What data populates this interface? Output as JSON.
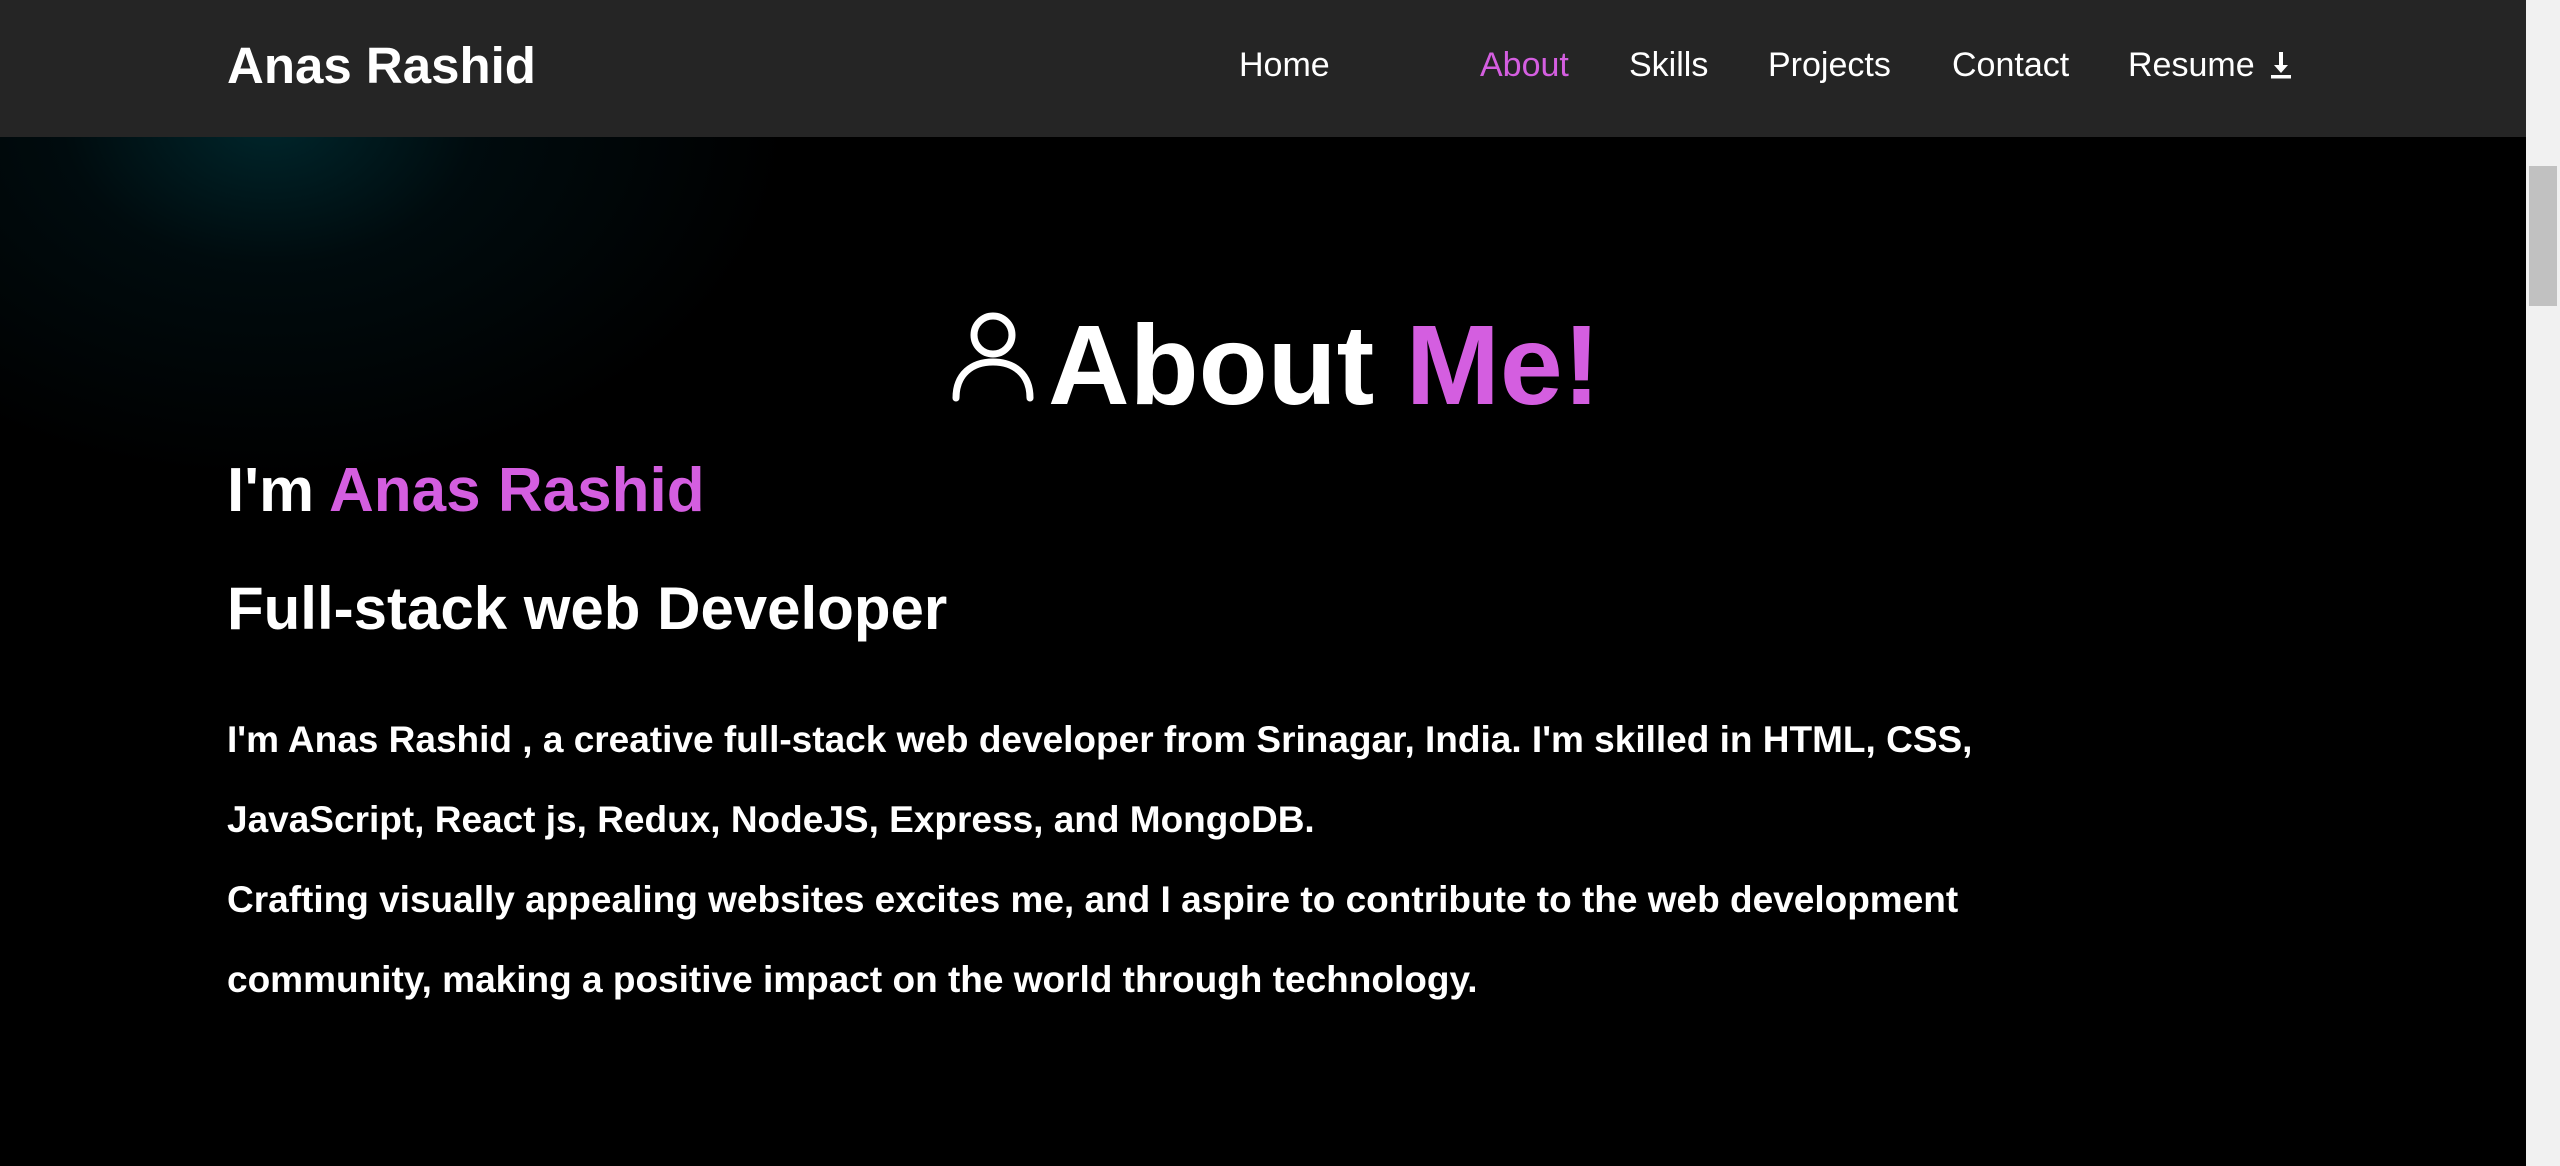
{
  "navbar": {
    "brand": "Anas Rashid",
    "items": [
      {
        "label": "Home",
        "active": false
      },
      {
        "label": "About",
        "active": true
      },
      {
        "label": "Skills",
        "active": false
      },
      {
        "label": "Projects",
        "active": false
      },
      {
        "label": "Contact",
        "active": false
      },
      {
        "label": "Resume",
        "active": false,
        "icon": "download-icon"
      }
    ]
  },
  "about": {
    "title_main": "About ",
    "title_accent": "Me!",
    "title_icon": "person-icon",
    "intro_prefix": "I'm ",
    "intro_name": "Anas Rashid",
    "role": "Full-stack web Developer",
    "paragraphs": [
      "I'm Anas Rashid , a creative full-stack web developer from Srinagar, India. I'm skilled in HTML, CSS, JavaScript, React js, Redux, NodeJS, Express, and MongoDB.",
      "Crafting visually appealing websites excites me, and I aspire to contribute to the web development community, making a positive impact on the world through technology."
    ]
  },
  "colors": {
    "accent": "#d45ee0",
    "navbar_bg": "#252525",
    "page_bg": "#000000",
    "text": "#ffffff"
  }
}
